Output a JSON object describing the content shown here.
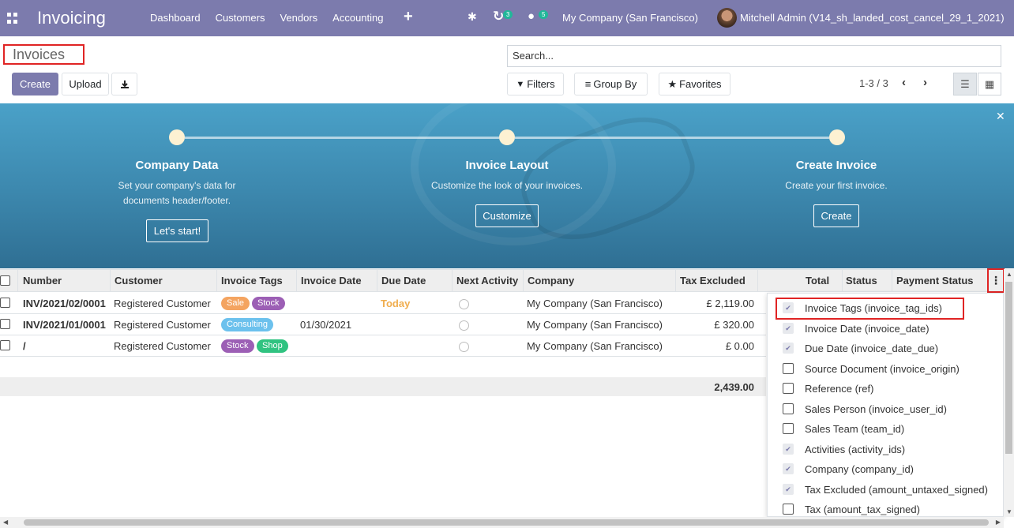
{
  "navbar": {
    "brand": "Invoicing",
    "menu": [
      "Dashboard",
      "Customers",
      "Vendors",
      "Accounting"
    ],
    "plus": "+",
    "activity_count": "3",
    "message_count": "5",
    "company": "My Company (San Francisco)",
    "user": "Mitchell Admin (V14_sh_landed_cost_cancel_29_1_2021)"
  },
  "control": {
    "breadcrumb": "Invoices",
    "create": "Create",
    "upload": "Upload",
    "search_placeholder": "Search...",
    "filters": "Filters",
    "group_by": "Group By",
    "favorites": "Favorites",
    "pager": "1-3 / 3"
  },
  "banner": {
    "steps": [
      {
        "title": "Company Data",
        "desc1": "Set your company's data for",
        "desc2": "documents header/footer.",
        "button": "Let's start!"
      },
      {
        "title": "Invoice Layout",
        "desc1": "Customize the look of your invoices.",
        "desc2": "",
        "button": "Customize"
      },
      {
        "title": "Create Invoice",
        "desc1": "Create your first invoice.",
        "desc2": "",
        "button": "Create"
      }
    ]
  },
  "table": {
    "headers": [
      "Number",
      "Customer",
      "Invoice Tags",
      "Invoice Date",
      "Due Date",
      "Next Activity",
      "Company",
      "Tax Excluded",
      "Total",
      "Status",
      "Payment Status"
    ],
    "rows": [
      {
        "number": "INV/2021/02/0001",
        "customer": "Registered Customer",
        "tags": [
          "Sale",
          "Stock"
        ],
        "invoice_date": "",
        "due_date": "Today",
        "company": "My Company (San Francisco)",
        "tax_excluded": "£ 2,119.00"
      },
      {
        "number": "INV/2021/01/0001",
        "customer": "Registered Customer",
        "tags": [
          "Consulting"
        ],
        "invoice_date": "01/30/2021",
        "due_date": "",
        "company": "My Company (San Francisco)",
        "tax_excluded": "£ 320.00"
      },
      {
        "number": "/",
        "customer": "Registered Customer",
        "tags": [
          "Stock",
          "Shop"
        ],
        "invoice_date": "",
        "due_date": "",
        "company": "My Company (San Francisco)",
        "tax_excluded": "£ 0.00"
      }
    ],
    "total_tax_excluded": "2,439.00"
  },
  "optional_columns": [
    {
      "label": "Invoice Tags (invoice_tag_ids)",
      "checked": true
    },
    {
      "label": "Invoice Date (invoice_date)",
      "checked": true
    },
    {
      "label": "Due Date (invoice_date_due)",
      "checked": true
    },
    {
      "label": "Source Document (invoice_origin)",
      "checked": false
    },
    {
      "label": "Reference (ref)",
      "checked": false
    },
    {
      "label": "Sales Person (invoice_user_id)",
      "checked": false
    },
    {
      "label": "Sales Team (team_id)",
      "checked": false
    },
    {
      "label": "Activities (activity_ids)",
      "checked": true
    },
    {
      "label": "Company (company_id)",
      "checked": true
    },
    {
      "label": "Tax Excluded (amount_untaxed_signed)",
      "checked": true
    },
    {
      "label": "Tax (amount_tax_signed)",
      "checked": false
    }
  ],
  "colors": {
    "brand": "#7c7bad",
    "tag_sale": "#f4a460",
    "tag_stock": "#9c5fb5",
    "tag_consulting": "#6cc1ed",
    "tag_shop": "#30c381",
    "due_today": "#f0ad4e",
    "highlight": "#e02424"
  }
}
